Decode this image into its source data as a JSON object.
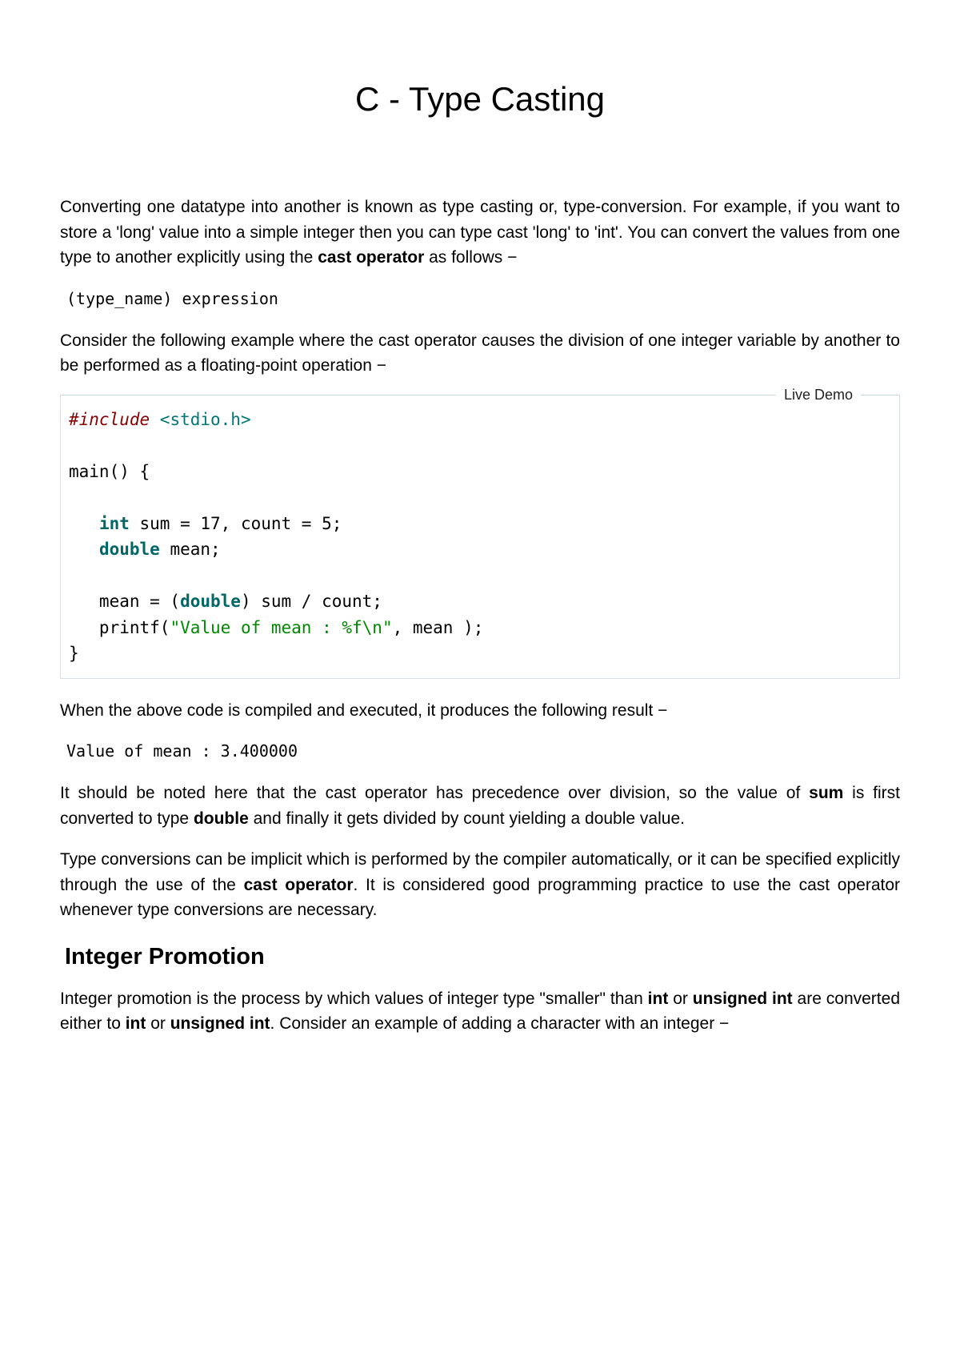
{
  "title": "C - Type Casting",
  "intro_part1": "Converting one datatype into another is known as type casting or, type-conversion. For example, if you want to store a 'long' value into a simple integer then you can type cast 'long' to 'int'. You can convert the values from one type to another explicitly using the ",
  "intro_bold1": "cast operator",
  "intro_part2": " as follows −",
  "syntax_code": "(type_name) expression",
  "para2": "Consider the following example where the cast operator causes the division of one integer variable by another to be performed as a floating-point operation −",
  "live_demo_label": "Live Demo",
  "code": {
    "l1_preproc": "#include ",
    "l1_header": "<stdio.h>",
    "l3": "main() {",
    "l5_indent": "   ",
    "l5_kw": "int",
    "l5_rest": " sum = 17, count = 5;",
    "l6_indent": "   ",
    "l6_kw": "double",
    "l6_rest": " mean;",
    "l8_indent": "   mean = (",
    "l8_kw": "double",
    "l8_rest": ") sum / count;",
    "l9_indent": "   printf(",
    "l9_str": "\"Value of mean : %f\\n\"",
    "l9_rest": ", mean );",
    "l10": "}"
  },
  "para3": "When the above code is compiled and executed, it produces the following result −",
  "output_code": "Value of mean : 3.400000",
  "para4_p1": "It should be noted here that the cast operator has precedence over division, so the value of ",
  "para4_b1": "sum",
  "para4_p2": " is first converted to type ",
  "para4_b2": "double",
  "para4_p3": " and finally it gets divided by count yielding a double value.",
  "para5_p1": "Type conversions can be implicit which is performed by the compiler automatically, or it can be specified explicitly through the use of the ",
  "para5_b1": "cast operator",
  "para5_p2": ". It is considered good programming practice to use the cast operator whenever type conversions are necessary.",
  "h2": "Integer Promotion",
  "para6_p1": "Integer promotion is the process by which values of integer type \"smaller\" than ",
  "para6_b1": "int",
  "para6_p2": " or ",
  "para6_b2": "unsigned int",
  "para6_p3": " are converted either to ",
  "para6_b3": "int",
  "para6_p4": " or ",
  "para6_b4": "unsigned int",
  "para6_p5": ". Consider an example of adding a character with an integer −"
}
